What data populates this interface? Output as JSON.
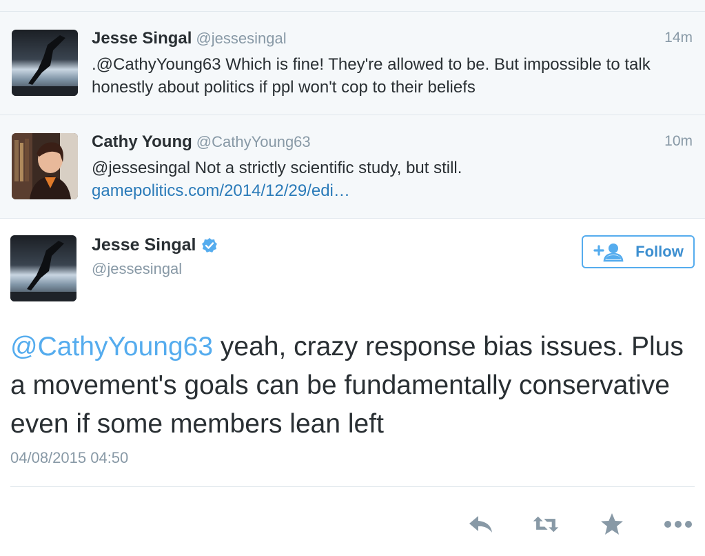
{
  "conversation": [
    {
      "name": "Jesse Singal",
      "handle": "@jessesingal",
      "time": "14m",
      "text": ".@CathyYoung63 Which is fine! They're allowed to be. But impossible to talk honestly about politics if ppl won't cop to their beliefs",
      "link": ""
    },
    {
      "name": "Cathy Young",
      "handle": "@CathyYoung63",
      "time": "10m",
      "text": "@jessesingal Not a strictly scientific study, but still. ",
      "link": "gamepolitics.com/2014/12/29/edi…"
    }
  ],
  "main_tweet": {
    "name": "Jesse Singal",
    "handle": "@jessesingal",
    "verified": true,
    "follow_label": "Follow",
    "mention": "@CathyYoung63",
    "text": " yeah, crazy response bias issues. Plus a movement's goals can be fundamentally conservative even if some members lean left",
    "timestamp": "04/08/2015 04:50"
  },
  "actions": [
    "reply-icon",
    "retweet-icon",
    "favorite-icon",
    "more-icon"
  ],
  "colors": {
    "link": "#2b7bb9",
    "mention": "#55acee",
    "muted": "#8899a6",
    "convo_bg": "#f5f8fa",
    "icon": "#8899a6"
  }
}
